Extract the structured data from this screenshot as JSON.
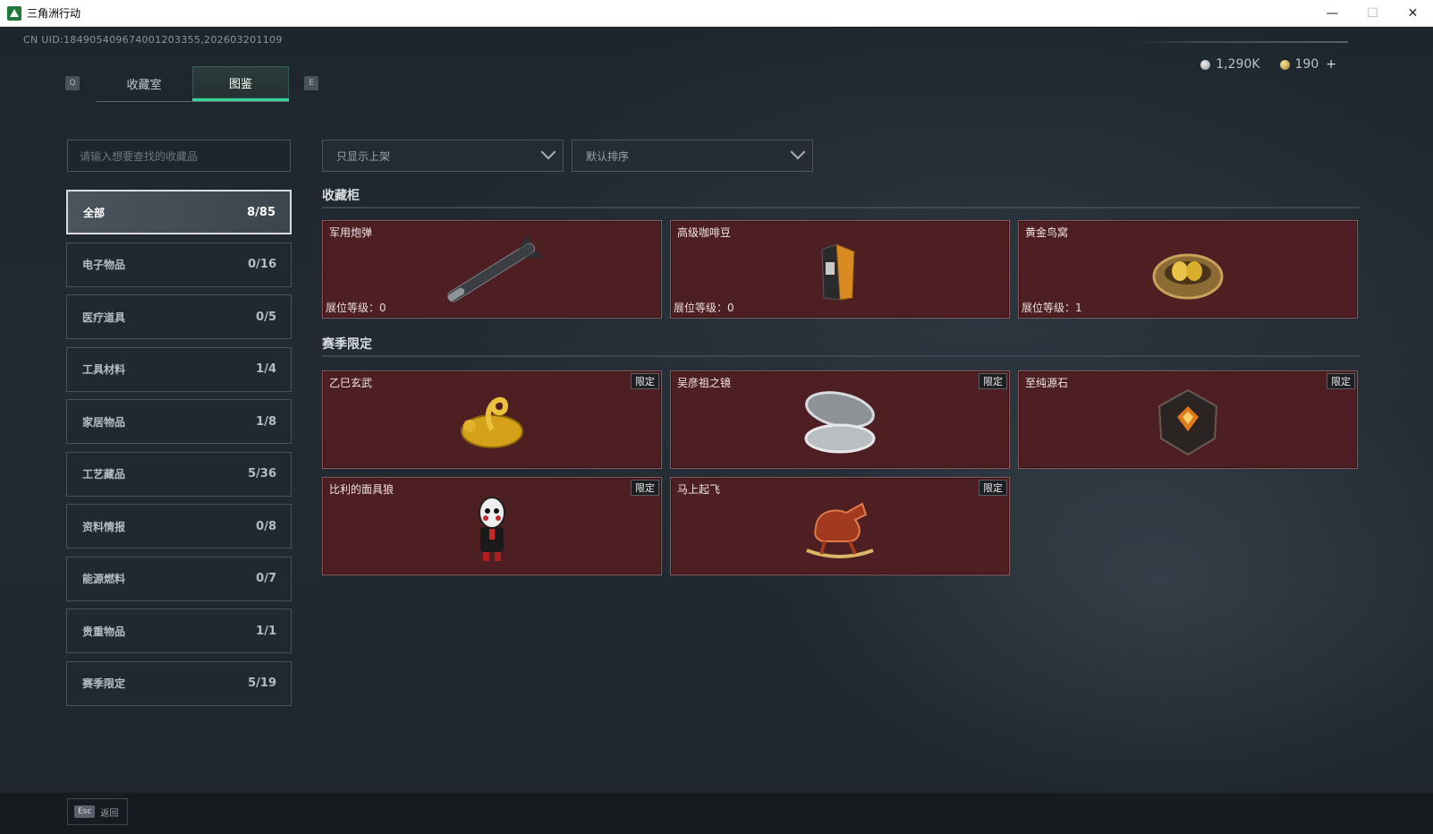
{
  "window": {
    "title": "三角洲行动",
    "minimize": "—",
    "maximize": "☐",
    "close": "✕",
    "accent": "#3ad39a"
  },
  "uid": "CN UID:184905409674001203355,202603201109",
  "tabs": {
    "prev_key": "Q",
    "next_key": "E",
    "items": [
      {
        "label": "收藏室",
        "active": false
      },
      {
        "label": "图鉴",
        "active": true
      }
    ]
  },
  "currency": {
    "silver": "1,290K",
    "gold": "190",
    "plus": "+"
  },
  "search": {
    "placeholder": "请输入想要查找的收藏品"
  },
  "filters": {
    "display": "只显示上架",
    "sort": "默认排序"
  },
  "categories": [
    {
      "label": "全部",
      "count": "8/85",
      "active": true
    },
    {
      "label": "电子物品",
      "count": "0/16"
    },
    {
      "label": "医疗道具",
      "count": "0/5"
    },
    {
      "label": "工具材料",
      "count": "1/4"
    },
    {
      "label": "家居物品",
      "count": "1/8"
    },
    {
      "label": "工艺藏品",
      "count": "5/36"
    },
    {
      "label": "资料情报",
      "count": "0/8"
    },
    {
      "label": "能源燃料",
      "count": "0/7"
    },
    {
      "label": "贵重物品",
      "count": "1/1"
    },
    {
      "label": "赛季限定",
      "count": "5/19"
    }
  ],
  "sections": {
    "cabinet": {
      "title": "收藏柜",
      "items": [
        {
          "name": "军用炮弹",
          "level": "展位等级：0",
          "icon": "missile-icon"
        },
        {
          "name": "高级咖啡豆",
          "level": "展位等级：0",
          "icon": "coffee-bag-icon"
        },
        {
          "name": "黄金鸟窝",
          "level": "展位等级：1",
          "icon": "golden-nest-icon"
        }
      ]
    },
    "season": {
      "title": "赛季限定",
      "badge": "限定",
      "items": [
        {
          "name": "乙巳玄武",
          "icon": "golden-turtle-snake-icon"
        },
        {
          "name": "吴彦祖之镜",
          "icon": "compact-mirror-icon"
        },
        {
          "name": "至纯源石",
          "icon": "source-crystal-icon"
        },
        {
          "name": "比利的面具狼",
          "icon": "billy-puppet-icon"
        },
        {
          "name": "马上起飞",
          "icon": "rocking-horse-icon"
        }
      ]
    }
  },
  "bottom": {
    "esc_key": "Esc",
    "back_label": "返回"
  }
}
